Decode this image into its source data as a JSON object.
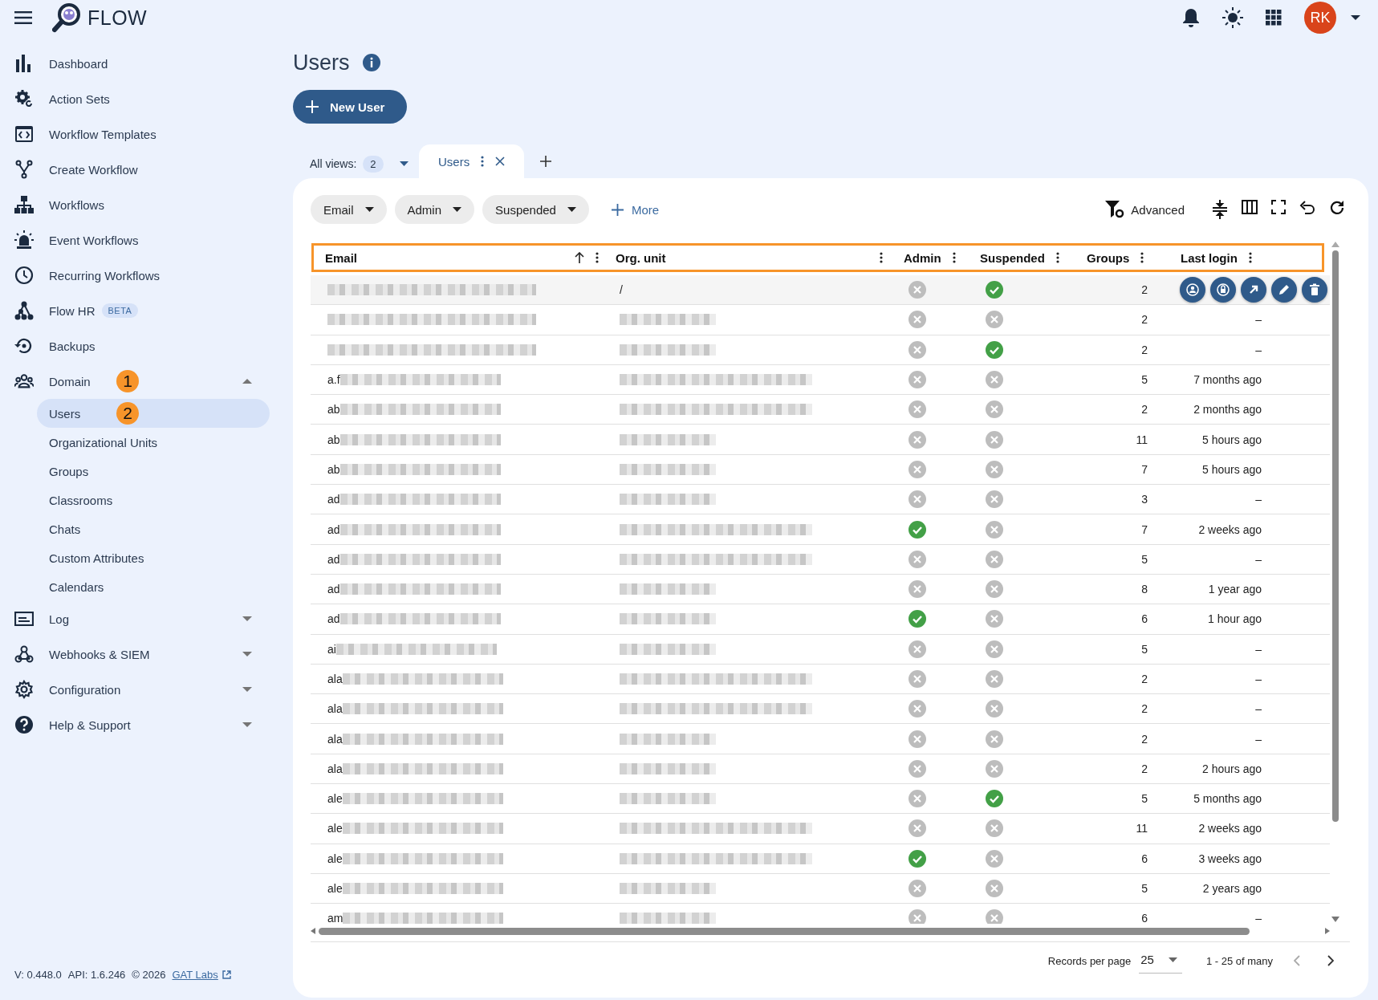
{
  "app": {
    "name": "FLOW",
    "avatar": "RK"
  },
  "sidebar": {
    "items": [
      {
        "label": "Dashboard",
        "selected": false
      },
      {
        "label": "Action Sets",
        "selected": false
      },
      {
        "label": "Workflow Templates",
        "selected": false
      },
      {
        "label": "Create Workflow",
        "selected": false
      },
      {
        "label": "Workflows",
        "selected": false
      },
      {
        "label": "Event Workflows",
        "selected": false
      },
      {
        "label": "Recurring Workflows",
        "selected": false
      },
      {
        "label": "Flow HR",
        "badge": "BETA",
        "selected": false
      },
      {
        "label": "Backups",
        "selected": false
      },
      {
        "label": "Domain",
        "marker": "1",
        "expanded": true,
        "selected": false,
        "children": [
          {
            "label": "Users",
            "marker": "2",
            "selected": true
          },
          {
            "label": "Organizational Units",
            "selected": false
          },
          {
            "label": "Groups",
            "selected": false
          },
          {
            "label": "Classrooms",
            "selected": false
          },
          {
            "label": "Chats",
            "selected": false
          },
          {
            "label": "Custom Attributes",
            "selected": false
          },
          {
            "label": "Calendars",
            "selected": false
          }
        ]
      },
      {
        "label": "Log",
        "expanded": false,
        "selected": false
      },
      {
        "label": "Webhooks & SIEM",
        "expanded": false,
        "selected": false
      },
      {
        "label": "Configuration",
        "expanded": false,
        "selected": false
      },
      {
        "label": "Help & Support",
        "expanded": false,
        "selected": false
      }
    ],
    "footer": {
      "version": "V: 0.448.0",
      "api": "API: 1.6.246",
      "copyright": "© 2026",
      "link": "GAT Labs"
    }
  },
  "page": {
    "title": "Users",
    "new_button": "New User"
  },
  "views": {
    "label": "All views:",
    "count": "2",
    "tabs": [
      {
        "label": "Users",
        "selected": true
      }
    ]
  },
  "filters": [
    {
      "label": "Email"
    },
    {
      "label": "Admin"
    },
    {
      "label": "Suspended"
    }
  ],
  "more": "More",
  "advanced": "Advanced",
  "table": {
    "highlighted": true,
    "columns": [
      {
        "label": "Email",
        "sorted": true
      },
      {
        "label": "Org. unit",
        "sorted": false
      },
      {
        "label": "Admin",
        "sorted": false
      },
      {
        "label": "Suspended",
        "sorted": false
      },
      {
        "label": "Groups",
        "sorted": false
      },
      {
        "label": "Last login",
        "sorted": false
      }
    ],
    "rows": [
      {
        "org_unit": "/",
        "admin": false,
        "suspended": true,
        "groups": "2",
        "hovered": true
      },
      {
        "admin": false,
        "suspended": false,
        "groups": "2",
        "last_login": "–",
        "hovered": false
      },
      {
        "admin": false,
        "suspended": true,
        "groups": "2",
        "last_login": "–",
        "hovered": false
      },
      {
        "email": "a.f",
        "admin": false,
        "suspended": false,
        "groups": "5",
        "last_login": "7 months ago",
        "hovered": false
      },
      {
        "email": "ab",
        "admin": false,
        "suspended": false,
        "groups": "2",
        "last_login": "2 months ago",
        "hovered": false
      },
      {
        "email": "ab",
        "admin": false,
        "suspended": false,
        "groups": "11",
        "last_login": "5 hours ago",
        "hovered": false
      },
      {
        "email": "ab",
        "admin": false,
        "suspended": false,
        "groups": "7",
        "last_login": "5 hours ago",
        "hovered": false
      },
      {
        "email": "ad",
        "admin": false,
        "suspended": false,
        "groups": "3",
        "last_login": "–",
        "hovered": false
      },
      {
        "email": "ad",
        "admin": true,
        "suspended": false,
        "groups": "7",
        "last_login": "2 weeks ago",
        "hovered": false
      },
      {
        "email": "ad",
        "admin": false,
        "suspended": false,
        "groups": "5",
        "last_login": "–",
        "hovered": false
      },
      {
        "email": "ad",
        "admin": false,
        "suspended": false,
        "groups": "8",
        "last_login": "1 year ago",
        "hovered": false
      },
      {
        "email": "ad",
        "admin": true,
        "suspended": false,
        "groups": "6",
        "last_login": "1 hour ago",
        "hovered": false
      },
      {
        "email": "ai",
        "admin": false,
        "suspended": false,
        "groups": "5",
        "last_login": "–",
        "hovered": false
      },
      {
        "email": "ala",
        "admin": false,
        "suspended": false,
        "groups": "2",
        "last_login": "–",
        "hovered": false
      },
      {
        "email": "ala",
        "admin": false,
        "suspended": false,
        "groups": "2",
        "last_login": "–",
        "hovered": false
      },
      {
        "email": "ala",
        "admin": false,
        "suspended": false,
        "groups": "2",
        "last_login": "–",
        "hovered": false
      },
      {
        "email": "ala",
        "admin": false,
        "suspended": false,
        "groups": "2",
        "last_login": "2 hours ago",
        "hovered": false
      },
      {
        "email": "ale",
        "admin": false,
        "suspended": true,
        "groups": "5",
        "last_login": "5 months ago",
        "hovered": false
      },
      {
        "email": "ale",
        "admin": false,
        "suspended": false,
        "groups": "11",
        "last_login": "2 weeks ago",
        "hovered": false
      },
      {
        "email": "ale",
        "admin": true,
        "suspended": false,
        "groups": "6",
        "last_login": "3 weeks ago",
        "hovered": false
      },
      {
        "email": "ale",
        "admin": false,
        "suspended": false,
        "groups": "5",
        "last_login": "2 years ago",
        "hovered": false
      },
      {
        "email": "am",
        "admin": false,
        "suspended": false,
        "groups": "6",
        "last_login": "–",
        "hovered": false
      }
    ]
  },
  "pagination": {
    "label": "Records per page",
    "per_page": "25",
    "range": "1 - 25 of many"
  }
}
